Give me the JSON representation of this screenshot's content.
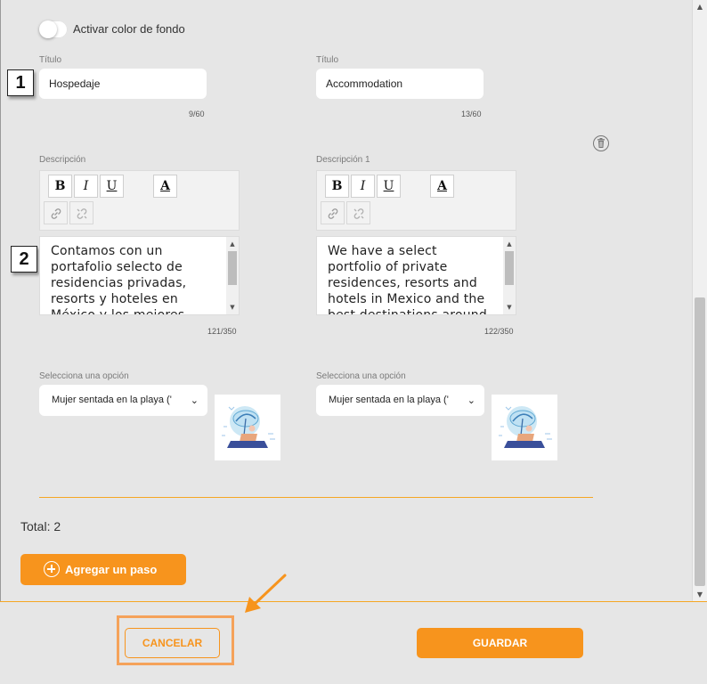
{
  "background_toggle": {
    "label": "Activar color de fondo",
    "on": false
  },
  "steps_annotations": {
    "one": "1",
    "two": "2"
  },
  "column_es": {
    "title_label": "Título",
    "title_value": "Hospedaje",
    "title_counter": "9/60",
    "desc_label": "Descripción",
    "desc_text": "Contamos con un portafolio selecto de residencias privadas, resorts y hoteles en México y los mejores",
    "desc_counter": "121/350",
    "select_label": "Selecciona una opción",
    "select_value": "Mujer sentada en la playa ('"
  },
  "column_en": {
    "title_label": "Título",
    "title_value": "Accommodation",
    "title_counter": "13/60",
    "desc_label": "Descripción 1",
    "desc_text": "We have a select portfolio of private residences, resorts and hotels in Mexico and the best destinations around",
    "desc_counter": "122/350",
    "select_label": "Selecciona una opción",
    "select_value": "Mujer sentada en la playa ('"
  },
  "toolbar": {
    "bold": "B",
    "italic": "I",
    "underline": "U",
    "font_color": "A"
  },
  "total_label": "Total: 2",
  "add_step_label": "Agregar un paso",
  "footer": {
    "cancel_label": "CANCELAR",
    "save_label": "GUARDAR"
  },
  "colors": {
    "accent": "#f7941d",
    "background": "#e6e6e6",
    "highlight": "#f5a25a"
  },
  "icons": [
    "trash-icon",
    "link-icon",
    "unlink-icon",
    "plus-circle-icon",
    "chevron-down-icon",
    "annotation-arrow-icon"
  ]
}
